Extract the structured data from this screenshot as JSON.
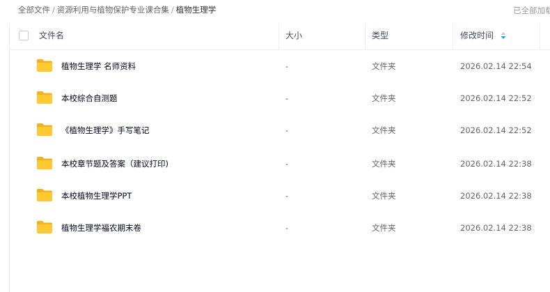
{
  "breadcrumb": {
    "items": [
      "全部文件",
      "资源利用与植物保护专业课合集"
    ],
    "current": "植物生理学",
    "separator": "/"
  },
  "status": {
    "loaded_text": "已全部加载"
  },
  "table": {
    "columns": {
      "name": "文件名",
      "size": "大小",
      "type": "类型",
      "modified": "修改时间"
    },
    "rows": [
      {
        "name": "植物生理学 名师资料",
        "size": "-",
        "type": "文件夹",
        "modified": "2026.02.14 22:54"
      },
      {
        "name": "本校综合自测题",
        "size": "-",
        "type": "文件夹",
        "modified": "2026.02.14 22:52"
      },
      {
        "name": "《植物生理学》手写笔记",
        "size": "-",
        "type": "文件夹",
        "modified": "2026.02.14 22:52"
      },
      {
        "name": "本校章节题及答案（建议打印)",
        "size": "-",
        "type": "文件夹",
        "modified": "2026.02.14 22:38"
      },
      {
        "name": "本校植物生理学PPT",
        "size": "-",
        "type": "文件夹",
        "modified": "2026.02.14 22:38"
      },
      {
        "name": "植物生理学福农期末卷",
        "size": "-",
        "type": "文件夹",
        "modified": "2026.02.14 22:38"
      }
    ]
  },
  "colors": {
    "folder_body": "#ffc933",
    "folder_tab": "#f5b01a",
    "sort_active": "#06a7ff",
    "sort_inactive": "#c9ccd3"
  },
  "icons": {
    "folder": "folder-icon",
    "sort": "sort-icon"
  }
}
